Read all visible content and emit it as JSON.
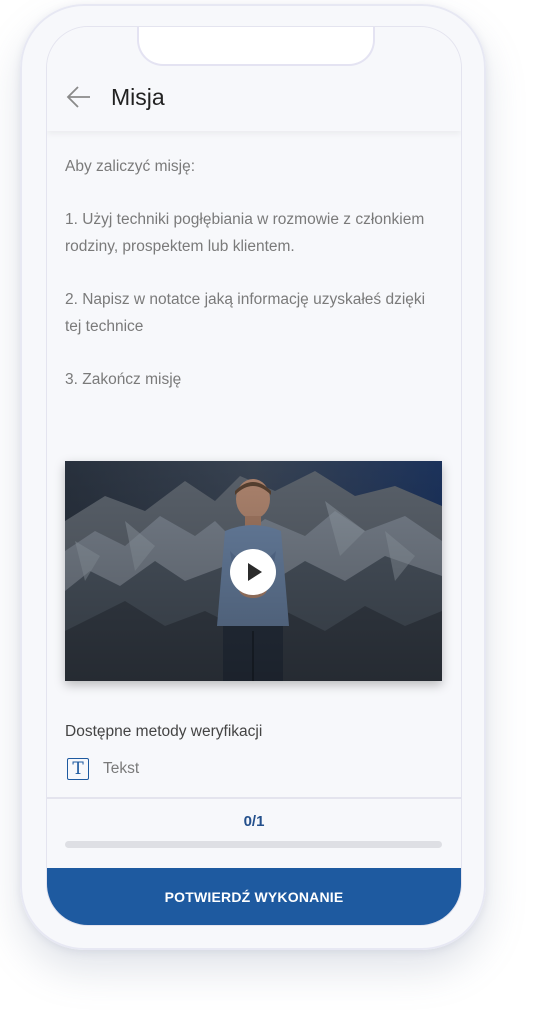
{
  "header": {
    "title": "Misja",
    "back_icon": "arrow-left-icon"
  },
  "instructions": {
    "intro": "Aby zaliczyć misję:",
    "step1": "1. Użyj techniki pogłębiania w rozmowie z członkiem rodziny, prospektem lub klientem.",
    "step2": "2. Napisz w notatce jaką informację uzyskałeś dzięki tej technice",
    "step3": "3. Zakończ misję"
  },
  "video": {
    "play_icon": "play-icon"
  },
  "verification": {
    "title": "Dostępne metody weryfikacji",
    "methods": [
      {
        "label": "Tekst",
        "icon": "text-format-icon"
      }
    ]
  },
  "progress": {
    "label": "0/1",
    "fraction": 0
  },
  "actions": {
    "confirm_label": "POTWIERDŹ WYKONANIE"
  },
  "colors": {
    "primary": "#1e5aa0",
    "progress_text": "#24508c",
    "body_text": "#7a7a7a"
  }
}
